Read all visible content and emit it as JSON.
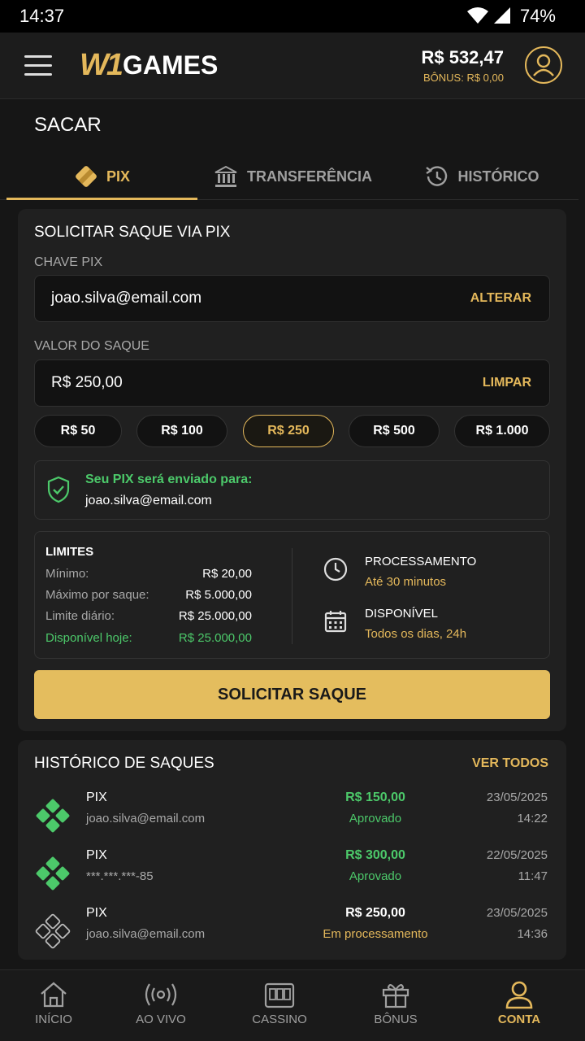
{
  "status": {
    "time": "14:37",
    "battery": "74%"
  },
  "header": {
    "logo_mark": "W1",
    "logo_text": "GAMES",
    "balance": "R$ 532,47",
    "bonus": "BÔNUS: R$ 0,00"
  },
  "page": {
    "title": "SACAR"
  },
  "tabs": [
    {
      "label": "PIX",
      "icon": "pix-icon",
      "active": true
    },
    {
      "label": "TRANSFERÊNCIA",
      "icon": "bank-icon",
      "active": false
    },
    {
      "label": "HISTÓRICO",
      "icon": "history-icon",
      "active": false
    }
  ],
  "form": {
    "title": "SOLICITAR SAQUE VIA PIX",
    "pix_label": "CHAVE PIX",
    "pix_value": "joao.silva@email.com",
    "pix_action": "ALTERAR",
    "amount_label": "VALOR DO SAQUE",
    "amount_value": "R$ 250,00",
    "amount_action": "LIMPAR",
    "chips": [
      "R$ 50",
      "R$ 100",
      "R$ 250",
      "R$ 500",
      "R$ 1.000"
    ],
    "selected_chip": "R$ 250",
    "notice_title": "Seu PIX será enviado para:",
    "notice_value": "joao.silva@email.com",
    "limits": {
      "title": "LIMITES",
      "rows": [
        {
          "label": "Mínimo:",
          "value": "R$ 20,00"
        },
        {
          "label": "Máximo por saque:",
          "value": "R$ 5.000,00"
        },
        {
          "label": "Limite diário:",
          "value": "R$ 25.000,00"
        },
        {
          "label": "Disponível hoje:",
          "value": "R$ 25.000,00"
        }
      ]
    },
    "processing_title": "PROCESSAMENTO",
    "processing_value": "Até 30 minutos",
    "available_title": "DISPONÍVEL",
    "available_value": "Todos os dias, 24h",
    "submit": "SOLICITAR SAQUE"
  },
  "history": {
    "title": "HISTÓRICO DE SAQUES",
    "see_all": "VER TODOS",
    "items": [
      {
        "method": "PIX",
        "key": "joao.silva@email.com",
        "amount": "R$ 150,00",
        "status": "Aprovado",
        "date": "23/05/2025",
        "time": "14:22"
      },
      {
        "method": "PIX",
        "key": "***.***.***-85",
        "amount": "R$ 300,00",
        "status": "Aprovado",
        "date": "22/05/2025",
        "time": "11:47"
      },
      {
        "method": "PIX",
        "key": "joao.silva@email.com",
        "amount": "R$ 250,00",
        "status": "Em processamento",
        "date": "23/05/2025",
        "time": "14:36"
      }
    ]
  },
  "nav": [
    {
      "label": "INÍCIO",
      "icon": "home-icon"
    },
    {
      "label": "AO VIVO",
      "icon": "live-icon"
    },
    {
      "label": "CASSINO",
      "icon": "slot-icon"
    },
    {
      "label": "BÔNUS",
      "icon": "gift-icon"
    },
    {
      "label": "CONTA",
      "icon": "user-icon",
      "active": true
    }
  ],
  "colors": {
    "accent": "#e4b85b",
    "success": "#4cc96a",
    "background": "#161616",
    "card": "#202020"
  }
}
